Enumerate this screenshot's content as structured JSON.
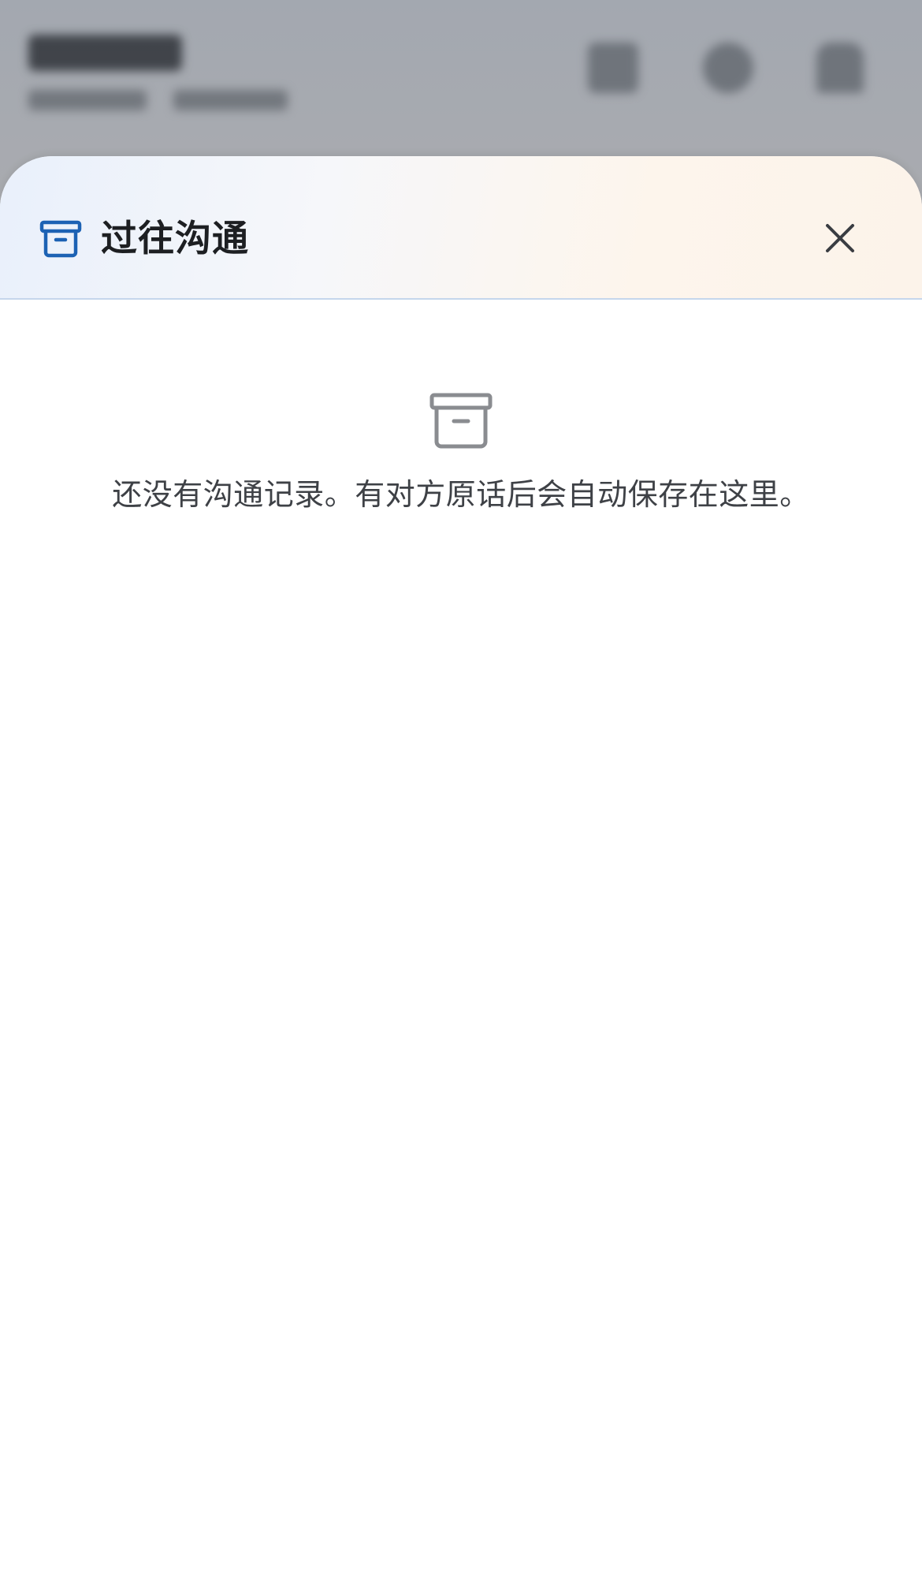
{
  "sheet": {
    "title": "过往沟通",
    "title_icon": "archive-box-icon",
    "close_icon": "close-icon",
    "accent_color": "#1c62b4"
  },
  "empty_state": {
    "icon": "archive-box-icon",
    "message": "还没有沟通记录。有对方原话后会自动保存在这里。"
  }
}
